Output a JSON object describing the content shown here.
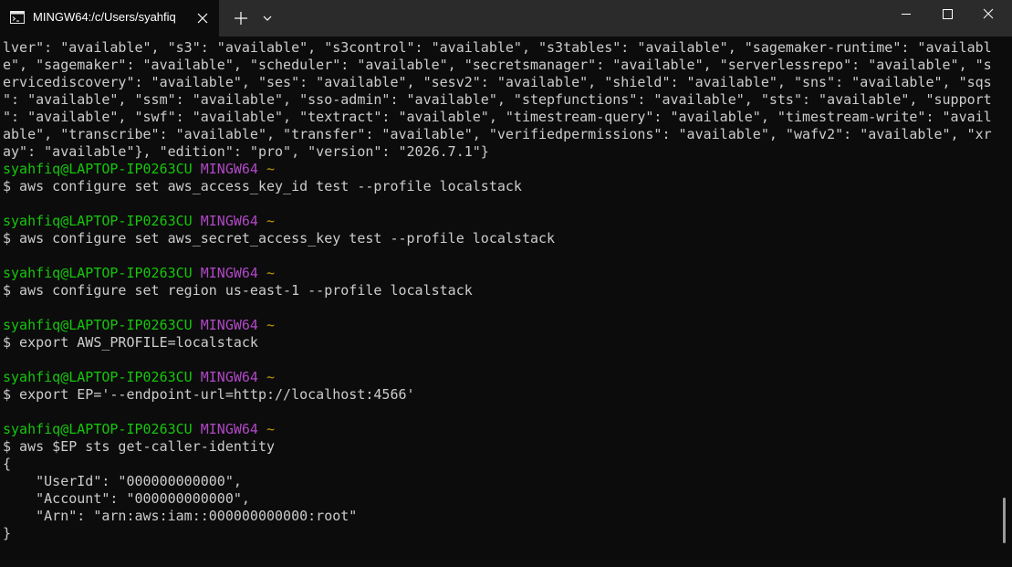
{
  "window": {
    "tab_title": "MINGW64:/c/Users/syahfiq",
    "icons": {
      "tab_icon": "terminal-app-icon",
      "tab_close": "close-icon",
      "new_tab": "plus-icon",
      "dropdown": "chevron-down-icon",
      "minimize": "minimize-icon",
      "maximize": "maximize-icon",
      "close": "close-icon"
    }
  },
  "colors": {
    "background": "#0c0c0c",
    "titlebar": "#2b2b2b",
    "text": "#cccccc",
    "prompt_user": "#16c60c",
    "prompt_env": "#b148c6",
    "prompt_path": "#c19c00"
  },
  "prompt": {
    "user": "syahfiq@LAPTOP-IP0263CU",
    "env": "MINGW64",
    "path": "~"
  },
  "output_top": [
    "lver\": \"available\", \"s3\": \"available\", \"s3control\": \"available\", \"s3tables\": \"available\", \"sagemaker-runtime\": \"availabl",
    "e\", \"sagemaker\": \"available\", \"scheduler\": \"available\", \"secretsmanager\": \"available\", \"serverlessrepo\": \"available\", \"s",
    "ervicediscovery\": \"available\", \"ses\": \"available\", \"sesv2\": \"available\", \"shield\": \"available\", \"sns\": \"available\", \"sqs",
    "\": \"available\", \"ssm\": \"available\", \"sso-admin\": \"available\", \"stepfunctions\": \"available\", \"sts\": \"available\", \"support",
    "\": \"available\", \"swf\": \"available\", \"textract\": \"available\", \"timestream-query\": \"available\", \"timestream-write\": \"avail",
    "able\", \"transcribe\": \"available\", \"transfer\": \"available\", \"verifiedpermissions\": \"available\", \"wafv2\": \"available\", \"xr",
    "ay\": \"available\"}, \"edition\": \"pro\", \"version\": \"2026.7.1\"}"
  ],
  "commands": [
    "$ aws configure set aws_access_key_id test --profile localstack",
    "$ aws configure set aws_secret_access_key test --profile localstack",
    "$ aws configure set region us-east-1 --profile localstack",
    "$ export AWS_PROFILE=localstack",
    "$ export EP='--endpoint-url=http://localhost:4566'",
    "$ aws $EP sts get-caller-identity"
  ],
  "output_bottom": [
    "{",
    "    \"UserId\": \"000000000000\",",
    "    \"Account\": \"000000000000\",",
    "    \"Arn\": \"arn:aws:iam::000000000000:root\"",
    "}"
  ]
}
